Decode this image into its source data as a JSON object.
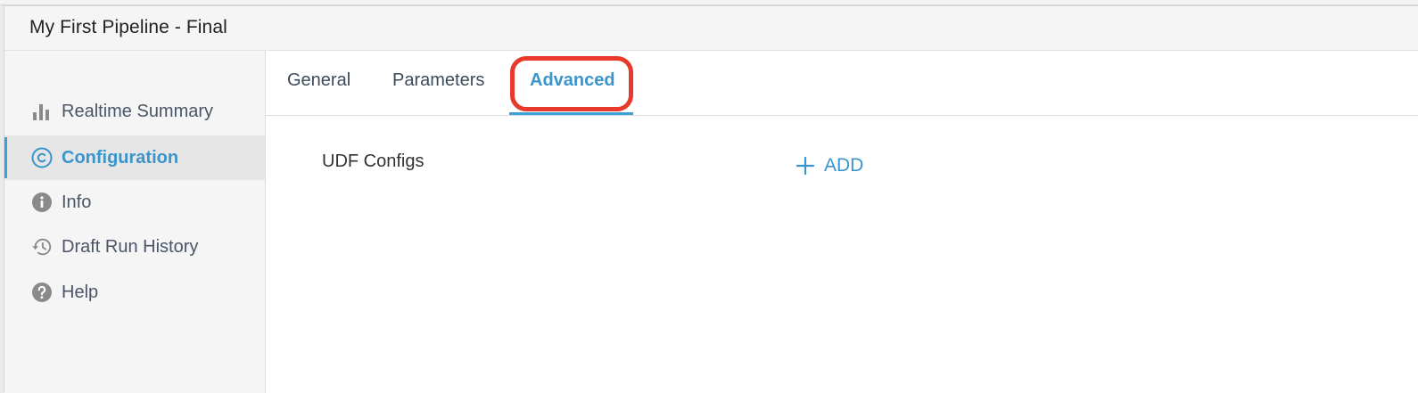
{
  "header": {
    "title": "My First Pipeline - Final"
  },
  "sidebar": {
    "items": [
      {
        "label": "Realtime Summary",
        "icon": "bar-chart-icon",
        "active": false
      },
      {
        "label": "Configuration",
        "icon": "circled-c-icon",
        "active": true
      },
      {
        "label": "Info",
        "icon": "info-icon",
        "active": false
      },
      {
        "label": "Draft Run History",
        "icon": "history-icon",
        "active": false
      },
      {
        "label": "Help",
        "icon": "help-icon",
        "active": false
      }
    ]
  },
  "tabs": [
    {
      "label": "General",
      "active": false
    },
    {
      "label": "Parameters",
      "active": false
    },
    {
      "label": "Advanced",
      "active": true
    }
  ],
  "content": {
    "section_label": "UDF Configs",
    "add_label": "ADD"
  },
  "colors": {
    "accent": "#3a95cc",
    "highlight": "#e8392a",
    "sidebar_bg": "#f5f5f5",
    "text": "#4a5568"
  }
}
